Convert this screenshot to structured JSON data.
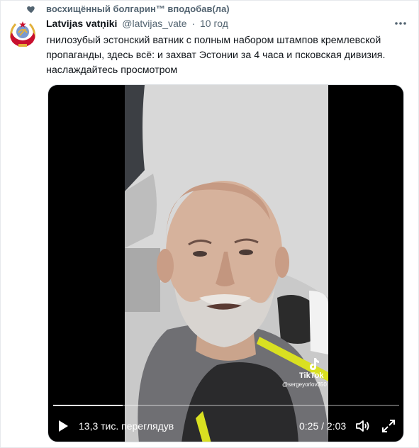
{
  "social_context": {
    "text": "восхищённый болгарин™ вподобав(ла)",
    "icon": "heart-icon"
  },
  "author": {
    "display_name": "Latvijas vatņiki",
    "handle": "@latvijas_vate",
    "separator": "·",
    "time": "10 год",
    "avatar_icon": "ussr-style-emblem-avatar"
  },
  "tweet": {
    "text": "гнилозубый эстонский ватник с полным набором штампов кремлевской пропаганды, здесь всё: и захват Эстонии за 4 часа и псковская дивизия. наслаждайтесь просмотром"
  },
  "video": {
    "views": "13,3 тис. переглядув",
    "current_time": "0:25",
    "separator": "/",
    "duration": "2:03",
    "progress_fraction": 0.2,
    "watermark_brand": "TikTok",
    "watermark_user": "@sergeyorlov350",
    "controls": [
      "play-icon",
      "volume-icon",
      "fullscreen-icon"
    ]
  },
  "colors": {
    "secondary_text": "#536471",
    "primary_text": "#0f1419",
    "video_bg": "#000000",
    "avatar_red": "#c8102e",
    "avatar_gold": "#e2b13c"
  }
}
